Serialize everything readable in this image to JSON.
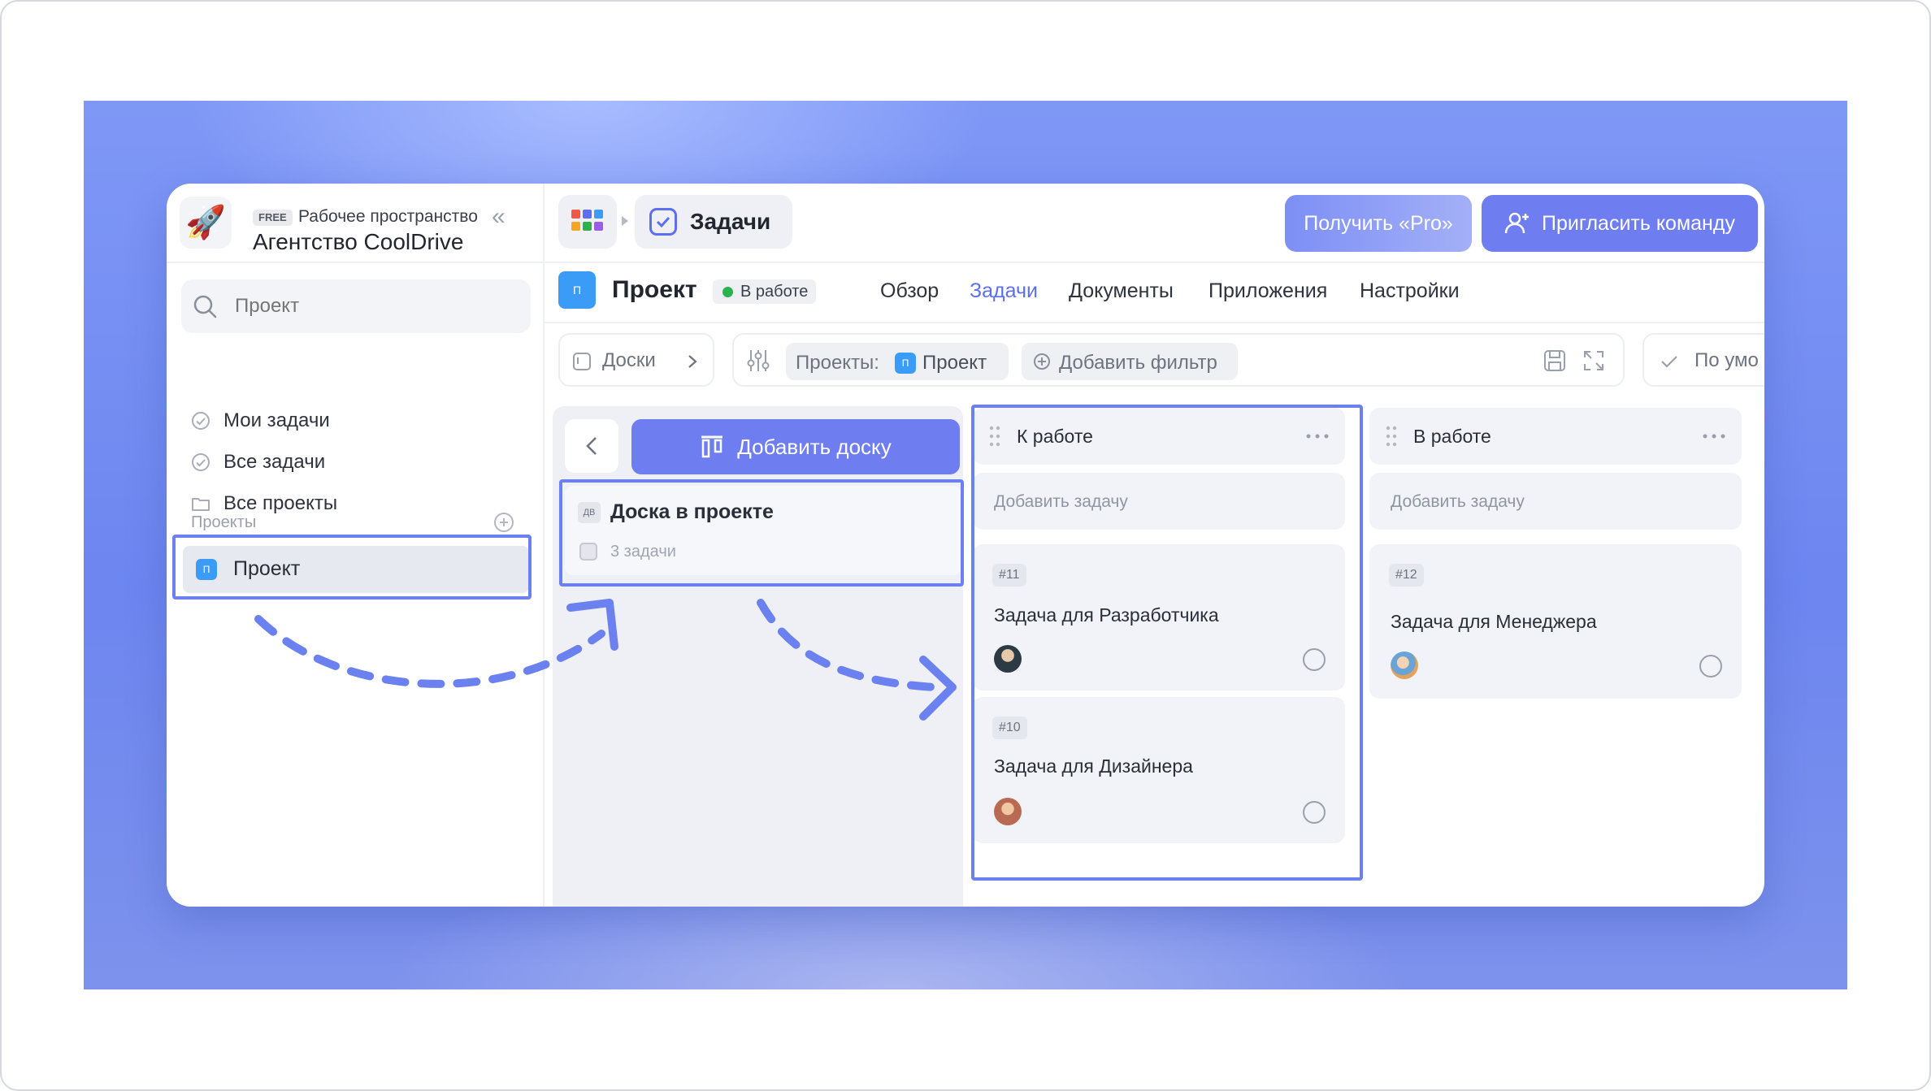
{
  "workspace": {
    "plan_badge": "FREE",
    "subtitle": "Рабочее пространство",
    "name": "Агентство CoolDrive"
  },
  "sidebar": {
    "search_placeholder": "Проект",
    "nav": [
      {
        "label": "Мои задачи",
        "icon": "check-circle-icon"
      },
      {
        "label": "Все задачи",
        "icon": "check-circle-icon"
      },
      {
        "label": "Все проекты",
        "icon": "folder-icon"
      }
    ],
    "projects_label": "Проекты",
    "projects": [
      {
        "label": "Проект",
        "badge": "П",
        "color": "#3a9cf7"
      }
    ]
  },
  "topbar": {
    "tab_label": "Задачи",
    "pro_button": "Получить «Pro»",
    "invite_button": "Пригласить команду"
  },
  "project_header": {
    "badge": "П",
    "title": "Проект",
    "status": "В работе",
    "tabs": [
      {
        "label": "Обзор",
        "active": false
      },
      {
        "label": "Задачи",
        "active": true
      },
      {
        "label": "Документы",
        "active": false
      },
      {
        "label": "Приложения",
        "active": false
      },
      {
        "label": "Настройки",
        "active": false
      }
    ]
  },
  "toolbar": {
    "boards_label": "Доски",
    "filter_prefix": "Проекты:",
    "filter_badge": "П",
    "filter_value": "Проект",
    "add_filter": "Добавить фильтр",
    "sort_label": "По умо"
  },
  "boards": {
    "add_button": "Добавить доску",
    "items": [
      {
        "badge": "ДВ",
        "title": "Доска в проекте",
        "count": "3 задачи"
      }
    ]
  },
  "columns": [
    {
      "title": "К работе",
      "add_task": "Добавить задачу",
      "tasks": [
        {
          "number": "#11",
          "title": "Задача для Разработчика"
        },
        {
          "number": "#10",
          "title": "Задача для Дизайнера"
        }
      ]
    },
    {
      "title": "В работе",
      "add_task": "Добавить задачу",
      "tasks": [
        {
          "number": "#12",
          "title": "Задача для Менеджера"
        }
      ]
    }
  ],
  "colors": {
    "accent": "#6e7df0",
    "highlight": "#6a81ef",
    "project_blue": "#3a9cf7",
    "status_green": "#2bb24c"
  }
}
